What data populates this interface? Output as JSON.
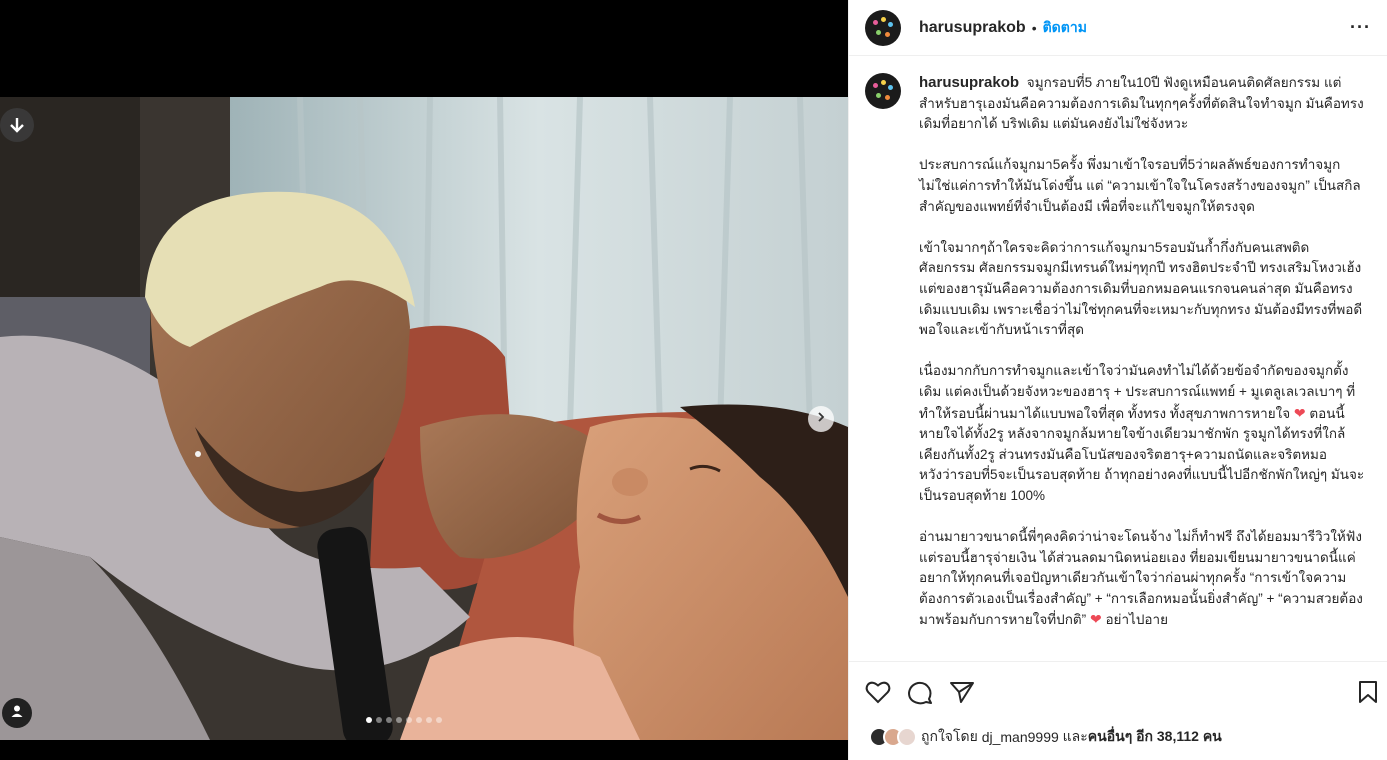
{
  "post": {
    "username": "harusuprakob",
    "separator": "•",
    "follow_label": "ติดตาม",
    "more_label": "···"
  },
  "media": {
    "slide_count": 8,
    "active_slide": 1,
    "next_icon": "chevron-right-icon",
    "tag_icon": "user-icon"
  },
  "caption": {
    "username": "harusuprakob",
    "paragraphs": [
      "จมูกรอบที่5 ภายใน10ปี ฟังดูเหมือนคนติดศัลยกรรม แต่สำหรับฮารุเองมันคือความต้องการเดิมในทุกๆครั้งที่ตัดสินใจทำจมูก มันคือทรงเดิมที่อยากได้ บริฟเดิม แต่มันคงยังไม่ใช่จังหวะ",
      "ประสบการณ์แก้จมูกมา5ครั้ง พึ่งมาเข้าใจรอบที่5ว่าผลลัพธ์ของการทำจมูกไม่ใช่แค่การทำให้มันโด่งขึ้น แต่ “ความเข้าใจในโครงสร้างของจมูก” เป็นสกิลสำคัญของแพทย์ที่จำเป็นต้องมี เพื่อที่จะแก้ไขจมูกให้ตรงจุด",
      "เข้าใจมากๆถ้าใครจะคิดว่าการแก้จมูกมา5รอบมันก้ำกึ่งกับคนเสพติดศัลยกรรม ศัลยกรรมจมูกมีเทรนด์ใหม่ๆทุกปี ทรงฮิตประจำปี ทรงเสริมโหงวเฮ้ง แต่ของฮารุมันคือความต้องการเดิมที่บอกหมอคนแรกจนคนล่าสุด มันคือทรงเดิมแบบเดิม เพราะเชื่อว่าไม่ใช่ทุกคนที่จะเหมาะกับทุกทรง มันต้องมีทรงที่พอดีพอใจและเข้ากับหน้าเราที่สุด"
    ],
    "para4_a": "เนื่องมากกับการทำจมูกและเข้าใจว่ามันคงทำไม่ได้ด้วยข้อจำกัดของจมูกตั้งเดิม แต่คงเป็นด้วยจังหวะของฮารุ + ประสบการณ์แพทย์ + มูเตลูเลเวลเบาๆ ที่ทำให้รอบนี้ผ่านมาได้แบบพอใจที่สุด ทั้งทรง ทั้งสุขภาพการหายใจ",
    "para4_heart": "❤",
    "para4_b": " ตอนนี้หายใจได้ทั้ง2รู หลังจากจมูกล้มหายใจข้างเดียวมาชักพัก รูจมูกได้ทรงที่ใกล้เคียงกันทั้ง2รู ส่วนทรงมันคือโบนัสของจริตฮารุ+ความถนัดและจริตหมอ",
    "para5": "หวังว่ารอบที่5จะเป็นรอบสุดท้าย ถ้าทุกอย่างคงที่แบบนี้ไปอีกชักพักใหญ่ๆ มันจะเป็นรอบสุดท้าย 100%",
    "para6_a": "อ่านมายาวขนาดนี้พี่ๆคงคิดว่าน่าจะโดนจ้าง ไม่ก็ทำฟรี ถึงได้ยอมมารีวิวให้ฟัง แต่รอบนี้ฮารุจ่ายเงิน ได้ส่วนลดมานิดหน่อยเอง ที่ยอมเขียนมายาวขนาดนี้แค่อยากให้ทุกคนที่เจอปัญหาเดียวกันเข้าใจว่าก่อนผ่าทุกครั้ง “การเข้าใจความต้องการตัวเองเป็นเรื่องสำคัญ” + “การเลือกหมอนั้นยิ่งสำคัญ” + “ความสวยต้องมาพร้อมกับการหายใจที่ปกติ”",
    "para6_heart": "❤",
    "para6_b": " อย่าไปอาย"
  },
  "actions": {
    "like_icon": "heart-icon",
    "comment_icon": "comment-icon",
    "share_icon": "send-icon",
    "save_icon": "bookmark-icon"
  },
  "likes": {
    "prefix": "ถูกใจโดย",
    "user": "dj_man9999",
    "and": "และ",
    "others": "คนอื่นๆ",
    "more": "อีก 38,112 คน"
  },
  "colors": {
    "accent": "#0095f6",
    "heart": "#ed4956",
    "text": "#262626",
    "media_bg": "#000000"
  }
}
